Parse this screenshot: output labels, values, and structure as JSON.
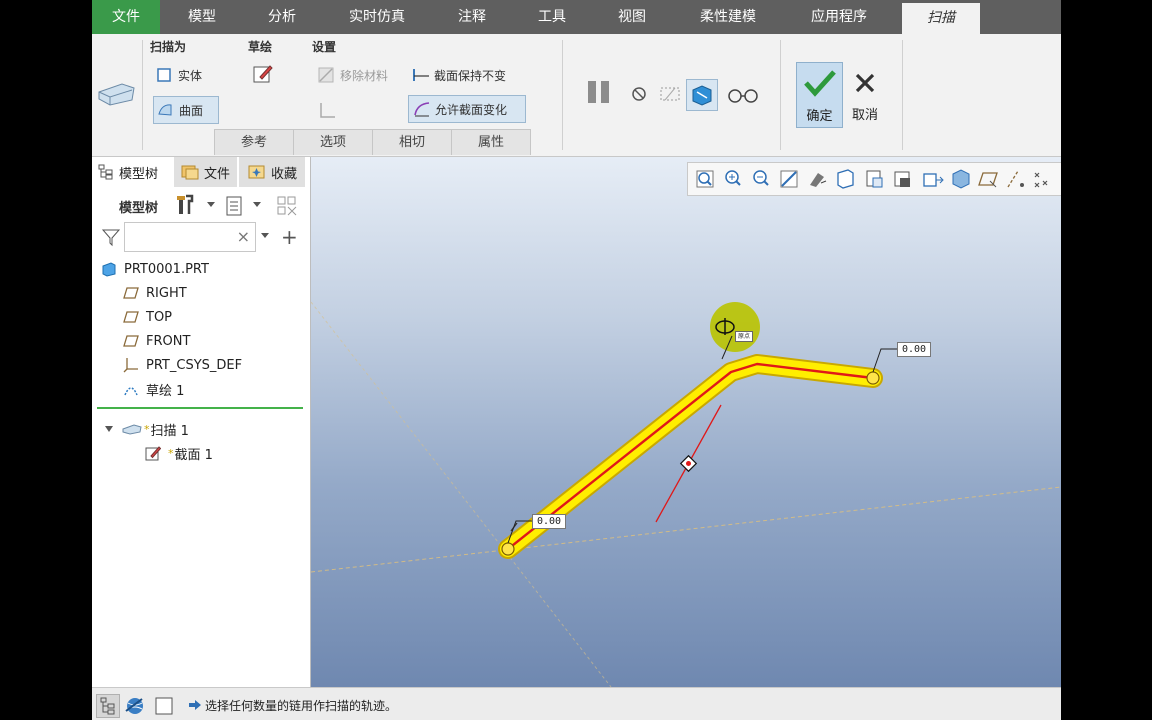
{
  "ribbon_tabs": [
    {
      "label": "文件"
    },
    {
      "label": "模型"
    },
    {
      "label": "分析"
    },
    {
      "label": "实时仿真"
    },
    {
      "label": "注释"
    },
    {
      "label": "工具"
    },
    {
      "label": "视图"
    },
    {
      "label": "柔性建模"
    },
    {
      "label": "应用程序"
    },
    {
      "label": "扫描"
    }
  ],
  "ribbon": {
    "sweep_as_label": "扫描为",
    "solid_label": "实体",
    "surface_label": "曲面",
    "sketch_label": "草绘",
    "settings_label": "设置",
    "remove_material_label": "移除材料",
    "keep_section_label": "截面保持不变",
    "allow_section_change_label": "允许截面变化",
    "confirm_label": "确定",
    "cancel_label": "取消",
    "subtabs": [
      {
        "label": "参考"
      },
      {
        "label": "选项"
      },
      {
        "label": "相切"
      },
      {
        "label": "属性"
      }
    ]
  },
  "panel": {
    "tabs": [
      {
        "label": "模型树"
      },
      {
        "label": "文件"
      },
      {
        "label": "收藏"
      }
    ],
    "tree_label": "模型树",
    "filter_clear": "×",
    "add_symbol": "+"
  },
  "tree": {
    "root": "PRT0001.PRT",
    "items": [
      {
        "label": "RIGHT"
      },
      {
        "label": "TOP"
      },
      {
        "label": "FRONT"
      },
      {
        "label": "PRT_CSYS_DEF"
      },
      {
        "label": "草绘 1"
      }
    ],
    "feature": "扫描 1",
    "feature_child": "截面 1",
    "new_marker": "*"
  },
  "viewport": {
    "dim_labels": [
      "0.00",
      "0.00"
    ],
    "tiny_tag": "原点"
  },
  "status": {
    "message": "选择任何数量的链用作扫描的轨迹。"
  },
  "colors": {
    "tab_bar": "#5f5f5f",
    "file_tab": "#3a9a4a",
    "trajectory": "#ffee00",
    "trajectory_center": "#e01818",
    "confirm_green": "#2e9a3c"
  }
}
